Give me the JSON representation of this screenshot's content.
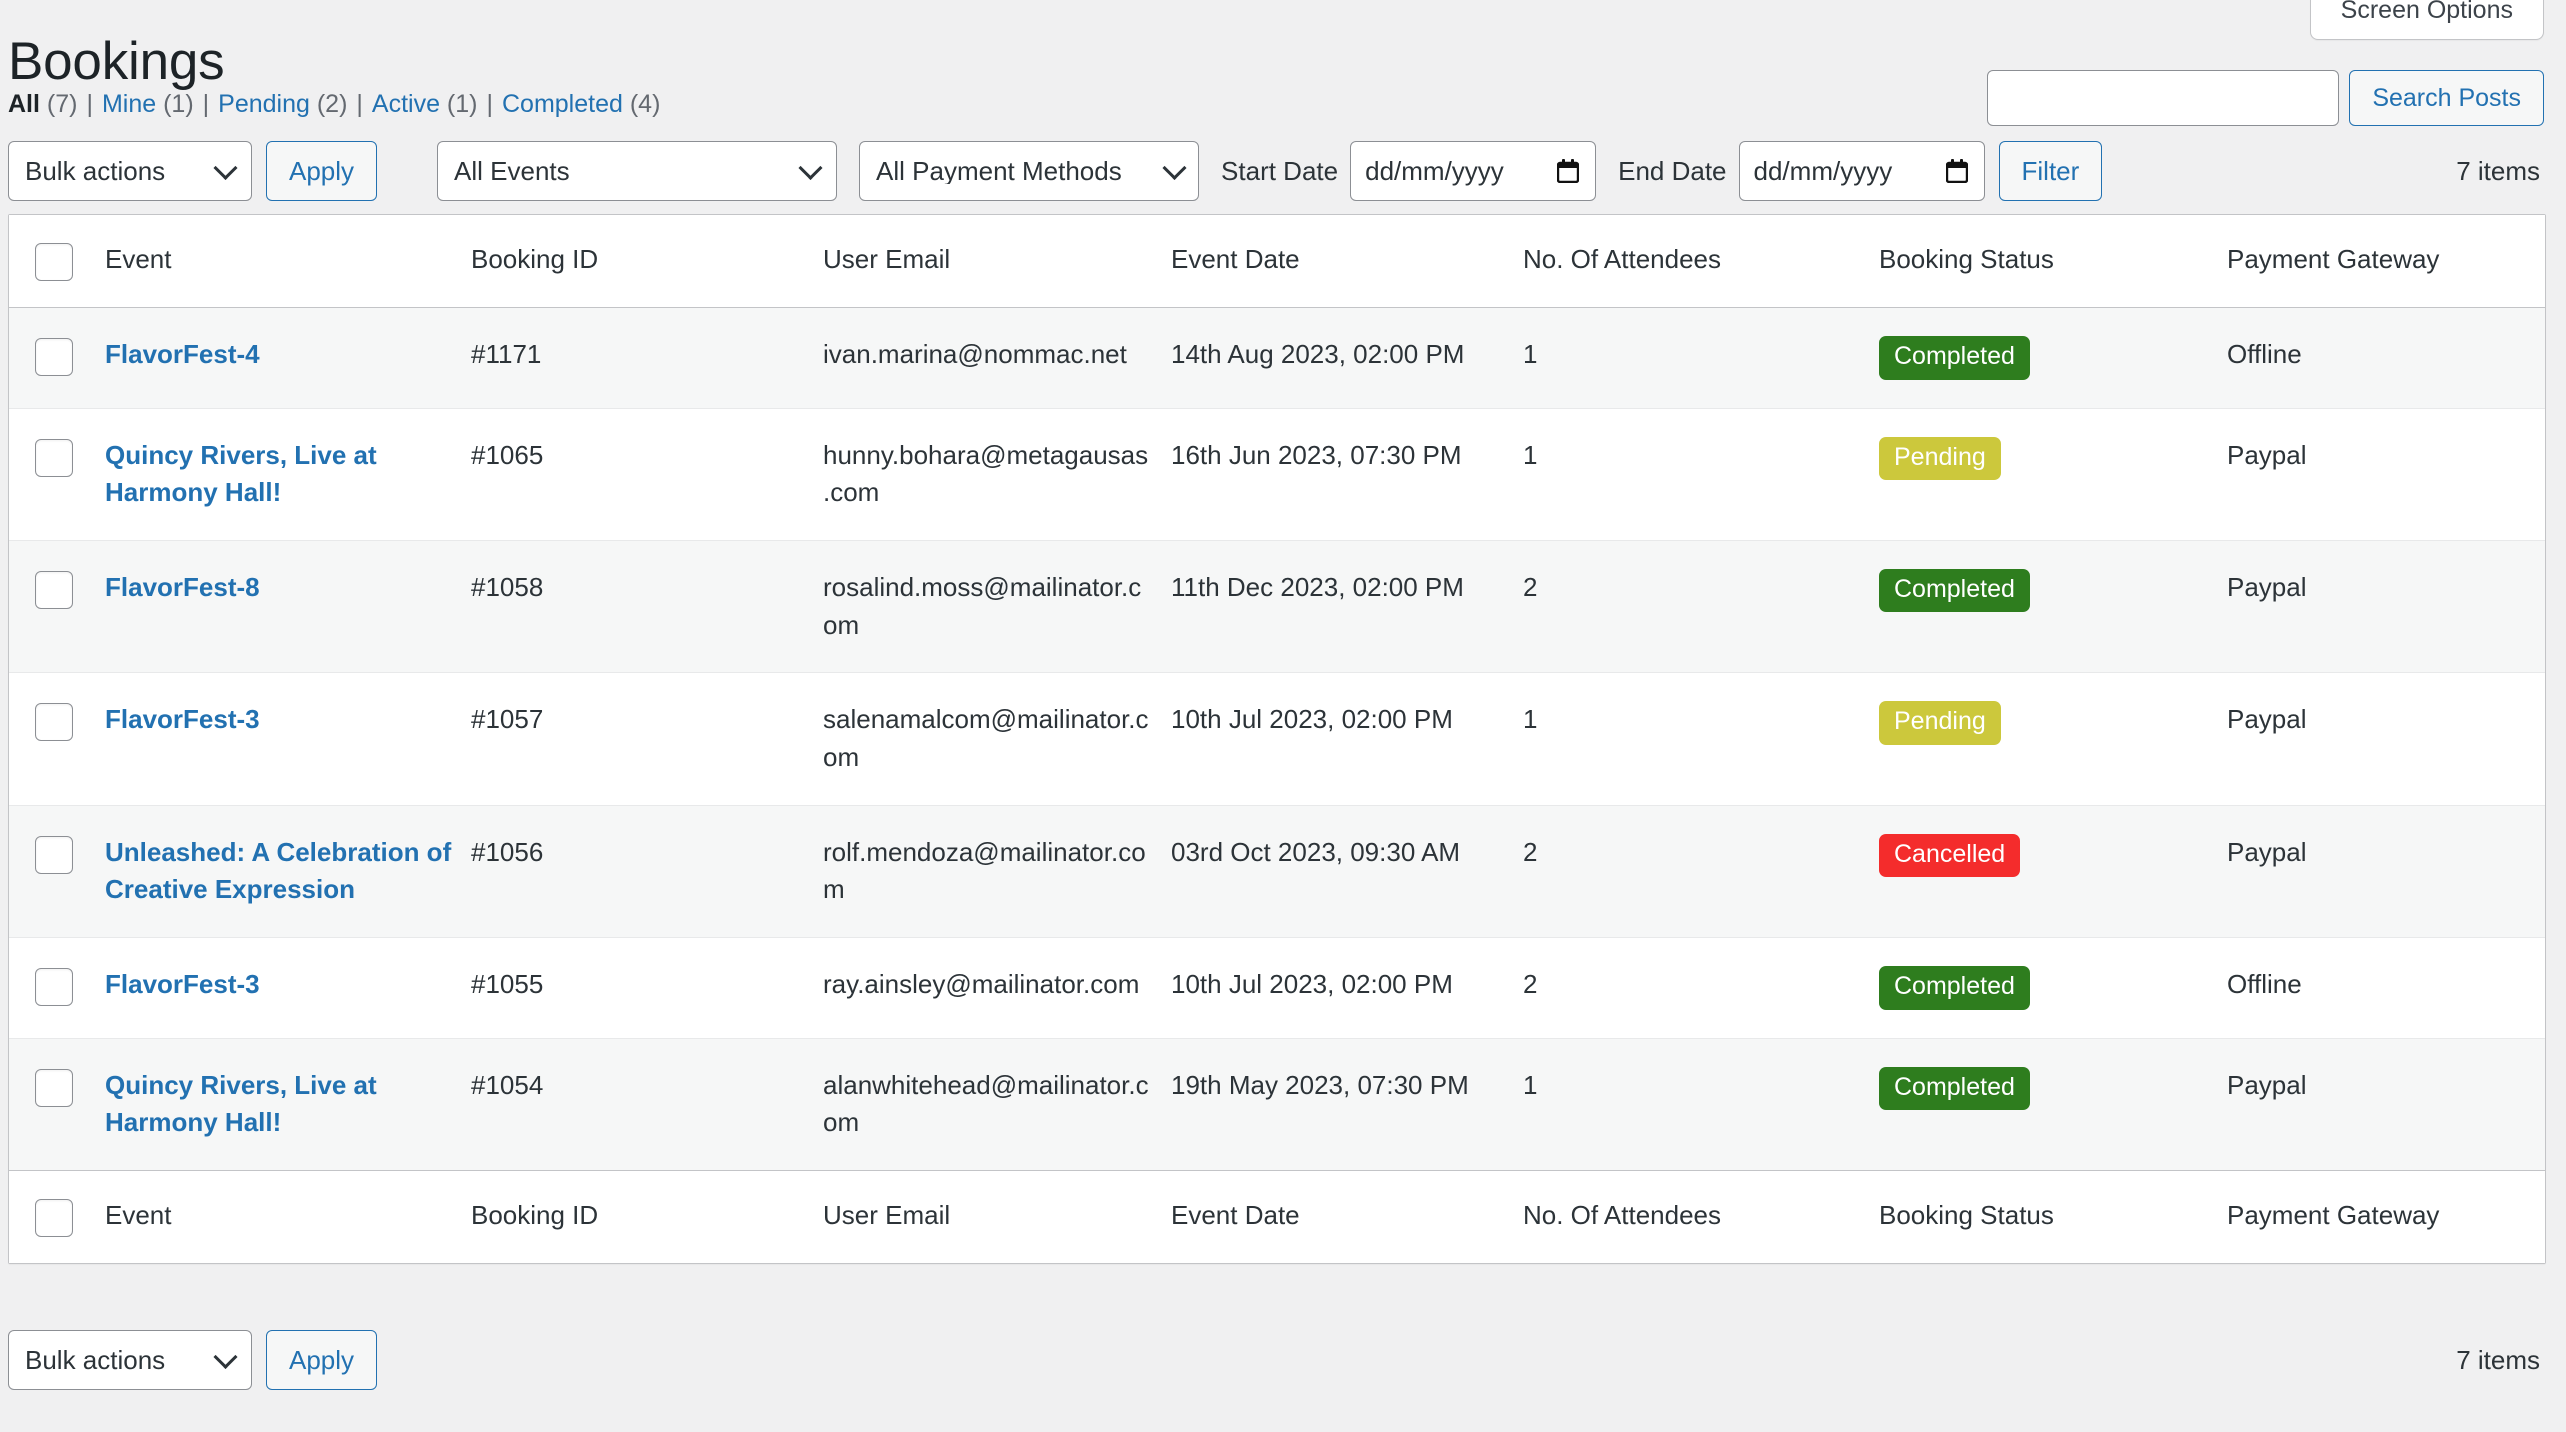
{
  "screen": {
    "screen_options_label": "Screen Options"
  },
  "header": {
    "title": "Bookings"
  },
  "views": {
    "items": [
      {
        "label": "All",
        "count": "(7)",
        "current": true
      },
      {
        "label": "Mine",
        "count": "(1)",
        "current": false
      },
      {
        "label": "Pending",
        "count": "(2)",
        "current": false
      },
      {
        "label": "Active",
        "count": "(1)",
        "current": false
      },
      {
        "label": "Completed",
        "count": "(4)",
        "current": false
      }
    ],
    "separator": "|"
  },
  "search": {
    "value": "",
    "placeholder": "",
    "button_label": "Search Posts"
  },
  "toolbar_top": {
    "bulk_actions_label": "Bulk actions",
    "apply_label": "Apply",
    "events_filter_label": "All Events",
    "payment_filter_label": "All Payment Methods",
    "start_date_label": "Start Date",
    "start_date_value": "dd/mm/yyyy",
    "end_date_label": "End Date",
    "end_date_value": "dd/mm/yyyy",
    "filter_label": "Filter",
    "items_count": "7 items"
  },
  "toolbar_bottom": {
    "bulk_actions_label": "Bulk actions",
    "apply_label": "Apply",
    "items_count": "7 items"
  },
  "table": {
    "columns": [
      "Event",
      "Booking ID",
      "User Email",
      "Event Date",
      "No. Of Attendees",
      "Booking Status",
      "Payment Gateway"
    ],
    "rows": [
      {
        "event": "FlavorFest-4",
        "booking_id": "#1171",
        "user_email": "ivan.marina@nommac.net",
        "event_date": "14th Aug 2023, 02:00 PM",
        "attendees": "1",
        "status": "Completed",
        "status_kind": "completed",
        "gateway": "Offline"
      },
      {
        "event": "Quincy Rivers, Live at Harmony Hall!",
        "booking_id": "#1065",
        "user_email": "hunny.bohara@metagausas.com",
        "event_date": "16th Jun 2023, 07:30 PM",
        "attendees": "1",
        "status": "Pending",
        "status_kind": "pending",
        "gateway": "Paypal"
      },
      {
        "event": "FlavorFest-8",
        "booking_id": "#1058",
        "user_email": "rosalind.moss@mailinator.com",
        "event_date": "11th Dec 2023, 02:00 PM",
        "attendees": "2",
        "status": "Completed",
        "status_kind": "completed",
        "gateway": "Paypal"
      },
      {
        "event": "FlavorFest-3",
        "booking_id": "#1057",
        "user_email": "salenamalcom@mailinator.com",
        "event_date": "10th Jul 2023, 02:00 PM",
        "attendees": "1",
        "status": "Pending",
        "status_kind": "pending",
        "gateway": "Paypal"
      },
      {
        "event": "Unleashed: A Celebration of Creative Expression",
        "booking_id": "#1056",
        "user_email": "rolf.mendoza@mailinator.com",
        "event_date": "03rd Oct 2023, 09:30 AM",
        "attendees": "2",
        "status": "Cancelled",
        "status_kind": "cancelled",
        "gateway": "Paypal"
      },
      {
        "event": "FlavorFest-3",
        "booking_id": "#1055",
        "user_email": "ray.ainsley@mailinator.com",
        "event_date": "10th Jul 2023, 02:00 PM",
        "attendees": "2",
        "status": "Completed",
        "status_kind": "completed",
        "gateway": "Offline"
      },
      {
        "event": "Quincy Rivers, Live at Harmony Hall!",
        "booking_id": "#1054",
        "user_email": "alanwhitehead@mailinator.com",
        "event_date": "19th May 2023, 07:30 PM",
        "attendees": "1",
        "status": "Completed",
        "status_kind": "completed",
        "gateway": "Paypal"
      }
    ]
  },
  "colors": {
    "link": "#2271b1",
    "completed": "#2e7d1e",
    "pending": "#ccc83c",
    "cancelled": "#f42c2c",
    "page_bg": "#f0f0f1",
    "row_alt_bg": "#f6f7f7"
  }
}
